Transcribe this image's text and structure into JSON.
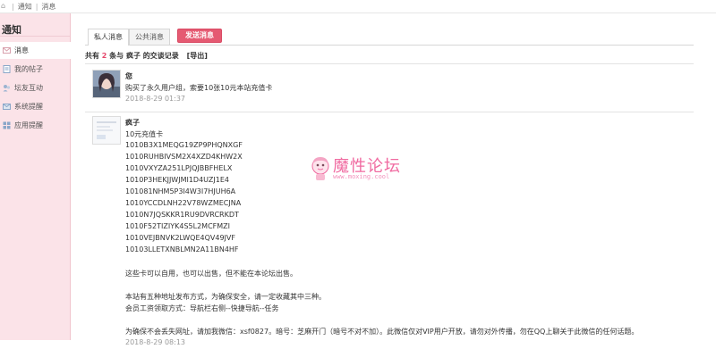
{
  "breadcrumb": {
    "items": [
      "通知",
      "消息"
    ]
  },
  "sidebar": {
    "title": "通知",
    "items": [
      {
        "label": "消息",
        "icon": "message-icon",
        "active": true
      },
      {
        "label": "我的帖子",
        "icon": "post-icon"
      },
      {
        "label": "坛友互动",
        "icon": "interaction-icon"
      },
      {
        "label": "系统提醒",
        "icon": "system-icon"
      },
      {
        "label": "应用提醒",
        "icon": "app-icon"
      }
    ]
  },
  "tabs": {
    "private": "私人消息",
    "public": "公共消息",
    "send": "发送消息"
  },
  "summary": {
    "prefix": "共有",
    "count": "2",
    "middle": "条与",
    "user": "疯子",
    "suffix": "的交谈记录",
    "export": "[导出]"
  },
  "messages": [
    {
      "name": "您",
      "text": "购买了永久用户组，索要10张10元本站充值卡",
      "time": "2018-8-29 01:37"
    },
    {
      "name": "疯子",
      "lines": [
        "10元充值卡",
        "1010B3X1MEQG19ZP9PHQNXGF",
        "1010RUHBIVSM2X4XZD4KHW2X",
        "1010VXYZA251LPJQJBBFHELX",
        "1010P3HEKJJWJMI1D4UZJ1E4",
        "101081NHM5P3I4W3I7HJUH6A",
        "1010YCCDLNH22V78WZMECJNA",
        "1010N7JQSKKR1RU9DVRCRKDT",
        "1010F52TIZIYK4S5L2MCFMZI",
        "1010VEJBNVK2LWQE4QV49JVF",
        "10103LLETXNBLMN2A11BN4HF"
      ],
      "note1": "这些卡可以自用，也可以出售，但不能在本论坛出售。",
      "note2": "本站有五种地址发布方式，为确保安全，请一定收藏其中三种。",
      "note3": "会员工资领取方式：导航栏右侧--快捷导航--任务",
      "note4": "为确保不会丢失网址，请加我微信：xsf0827。暗号：芝麻开门（暗号不对不加）。此微信仅对VIP用户开放，请勿对外传播，勿在QQ上聊关于此微信的任何话题。",
      "time": "2018-8-29 08:13"
    }
  ],
  "watermark": {
    "title": "魔性论坛",
    "url": "www.moxing.cool"
  },
  "colors": {
    "accent": "#e5476b",
    "sidebar": "#fbe3e8",
    "send_button": "#e55a72",
    "watermark": "#f06aa0"
  }
}
